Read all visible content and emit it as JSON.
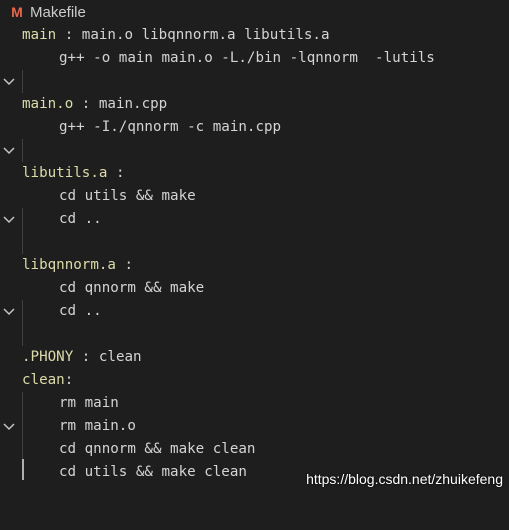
{
  "tab": {
    "icon": "makefile-m-icon",
    "icon_glyph": "M",
    "title": "Makefile"
  },
  "code": {
    "l1": {
      "target": "main",
      "sep": " : ",
      "deps": "main.o libqnnorm.a libutils.a"
    },
    "l2": {
      "text": "g++ -o main main.o -L./bin -lqnnorm  -lutils"
    },
    "l4": {
      "target": "main.o",
      "sep": " : ",
      "deps": "main.cpp"
    },
    "l5": {
      "text": "g++ -I./qnnorm -c main.cpp"
    },
    "l7": {
      "target": "libutils.a",
      "sep": " :",
      "deps": ""
    },
    "l8": {
      "text": "cd utils && make"
    },
    "l9": {
      "text": "cd .."
    },
    "l11": {
      "target": "libqnnorm.a",
      "sep": " :",
      "deps": ""
    },
    "l12": {
      "text": "cd qnnorm && make"
    },
    "l13": {
      "text": "cd .."
    },
    "l15": {
      "target": ".PHONY",
      "sep": " : ",
      "deps": "clean"
    },
    "l16": {
      "target": "clean",
      "sep": ":",
      "deps": ""
    },
    "l17": {
      "text": "rm main"
    },
    "l18": {
      "text": "rm main.o"
    },
    "l19": {
      "text": "cd qnnorm && make clean"
    },
    "l20": {
      "text": "cd utils && make clean"
    }
  },
  "colors": {
    "background": "#1e1e1e",
    "target": "#dcdcaa",
    "text": "#d4d4d4",
    "icon": "#e8674a"
  },
  "watermark": "https://blog.csdn.net/zhuikefeng"
}
